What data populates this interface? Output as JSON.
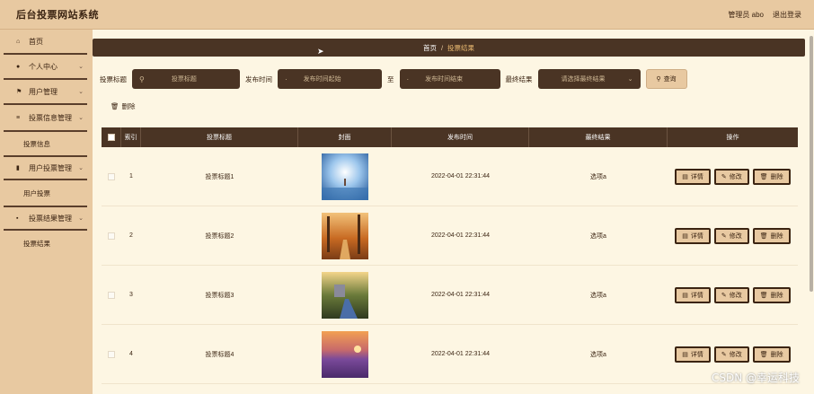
{
  "header": {
    "title": "后台投票网站系统",
    "user_label": "管理员 abo",
    "logout_label": "退出登录"
  },
  "sidebar": {
    "items": [
      {
        "label": "首页",
        "icon": "home-icon",
        "glyph": "⌂"
      },
      {
        "label": "个人中心",
        "icon": "user-icon",
        "glyph": "●",
        "chevron": "⌄"
      },
      {
        "label": "用户管理",
        "icon": "flag-icon",
        "glyph": "⚑",
        "chevron": "⌄"
      },
      {
        "label": "投票信息管理",
        "icon": "list-icon",
        "glyph": "≡",
        "chevron": "⌄"
      },
      {
        "label": "投票信息"
      },
      {
        "label": "用户投票管理",
        "icon": "bar-chart-icon",
        "glyph": "▮",
        "chevron": "⌄"
      },
      {
        "label": "用户投票"
      },
      {
        "label": "投票结果管理",
        "icon": "grid-icon",
        "glyph": "▪",
        "chevron": "⌄"
      },
      {
        "label": "投票结果"
      }
    ]
  },
  "breadcrumb": {
    "home": "首页",
    "sep": "/",
    "current": "投票结果"
  },
  "search": {
    "title_label": "投票标题",
    "title_placeholder": "投票标题",
    "time_label": "发布时间",
    "time_start_placeholder": "发布时间起始",
    "to_label": "至",
    "time_end_placeholder": "发布时间结束",
    "result_label": "最终结果",
    "result_placeholder": "请选择最终结果",
    "query_label": "查询"
  },
  "toolbar": {
    "delete_label": "删除"
  },
  "table": {
    "headers": {
      "index": "索引",
      "title": "投票标题",
      "cover": "封面",
      "time": "发布时间",
      "result": "最终结果",
      "ops": "操作"
    },
    "rows": [
      {
        "index": "1",
        "title": "投票标题1",
        "time": "2022-04-01 22:31:44",
        "result": "选项a"
      },
      {
        "index": "2",
        "title": "投票标题2",
        "time": "2022-04-01 22:31:44",
        "result": "选项a"
      },
      {
        "index": "3",
        "title": "投票标题3",
        "time": "2022-04-01 22:31:44",
        "result": "选项a"
      },
      {
        "index": "4",
        "title": "投票标题4",
        "time": "2022-04-01 22:31:44",
        "result": "选项a"
      }
    ],
    "ops": {
      "detail": "详情",
      "edit": "修改",
      "delete": "删除"
    }
  },
  "watermark": "CSDN @幸运科技",
  "colors": {
    "accent_dark": "#4a3424",
    "accent_light": "#e8c9a1",
    "background": "#fdf6e3"
  }
}
